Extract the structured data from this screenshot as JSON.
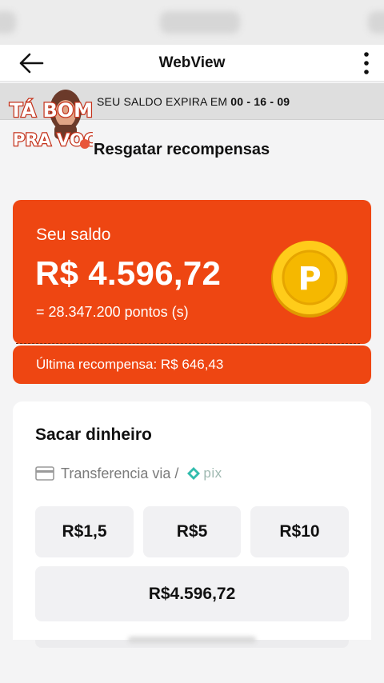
{
  "appbar": {
    "title": "WebView"
  },
  "expiry": {
    "label": "SEU SALDO EXPIRA EM",
    "countdown": "00 - 16 - 09"
  },
  "logo": {
    "line1": "TÁ BOM",
    "line2": "PRA VOCÊ?"
  },
  "page": {
    "heading": "Resgatar recompensas"
  },
  "balance": {
    "label": "Seu saldo",
    "amount": "R$ 4.596,72",
    "points": "= 28.347.200 pontos (s)",
    "coin_letter": "P"
  },
  "last_reward": {
    "text": "Última recompensa: R$ 646,43"
  },
  "withdraw": {
    "title": "Sacar dinheiro",
    "transfer_label": "Transferencia via /",
    "pix_label": "pix",
    "options": [
      "R$1,5",
      "R$5",
      "R$10",
      "R$4.596,72"
    ]
  },
  "colors": {
    "accent": "#ee4612",
    "coin": "#f5b800",
    "pix": "#32bcad"
  },
  "icons": [
    "back-arrow-icon",
    "more-vert-icon",
    "coin-icon",
    "card-icon",
    "pix-icon"
  ]
}
